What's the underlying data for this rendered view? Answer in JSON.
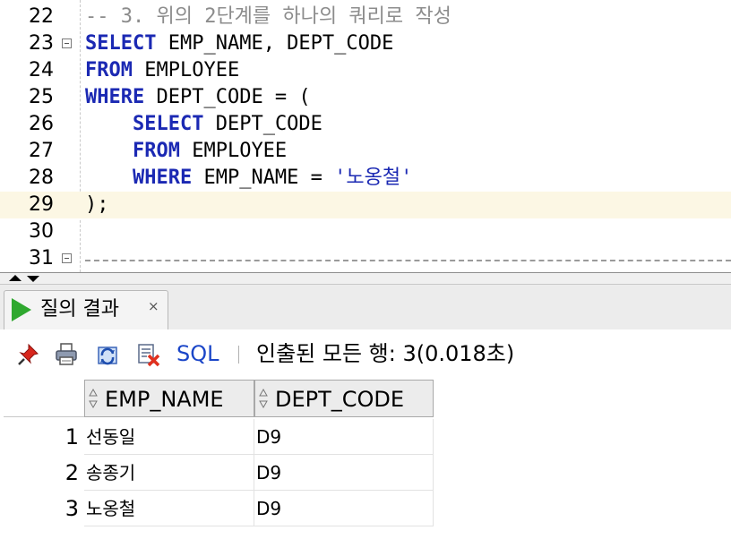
{
  "editor": {
    "lines": [
      {
        "num": "22",
        "tokens": [
          {
            "t": "-- 3. 위의 2단계를 하나의 쿼리로 작성",
            "c": "cmt"
          }
        ]
      },
      {
        "num": "23",
        "fold": true,
        "tokens": [
          {
            "t": "SELECT",
            "c": "kw"
          },
          {
            "t": " EMP_NAME, DEPT_CODE",
            "c": ""
          }
        ]
      },
      {
        "num": "24",
        "tokens": [
          {
            "t": "FROM",
            "c": "kw"
          },
          {
            "t": " EMPLOYEE",
            "c": ""
          }
        ]
      },
      {
        "num": "25",
        "tokens": [
          {
            "t": "WHERE",
            "c": "kw"
          },
          {
            "t": " DEPT_CODE = (",
            "c": ""
          }
        ]
      },
      {
        "num": "26",
        "tokens": [
          {
            "t": "    ",
            "c": ""
          },
          {
            "t": "SELECT",
            "c": "kw"
          },
          {
            "t": " DEPT_CODE",
            "c": ""
          }
        ]
      },
      {
        "num": "27",
        "tokens": [
          {
            "t": "    ",
            "c": ""
          },
          {
            "t": "FROM",
            "c": "kw"
          },
          {
            "t": " EMPLOYEE",
            "c": ""
          }
        ]
      },
      {
        "num": "28",
        "tokens": [
          {
            "t": "    ",
            "c": ""
          },
          {
            "t": "WHERE",
            "c": "kw"
          },
          {
            "t": " EMP_NAME = ",
            "c": ""
          },
          {
            "t": "'노옹철'",
            "c": "str"
          }
        ]
      },
      {
        "num": "29",
        "current": true,
        "tokens": [
          {
            "t": ");",
            "c": ""
          }
        ]
      },
      {
        "num": "30",
        "tokens": []
      },
      {
        "num": "31",
        "fold": true,
        "dashed": true,
        "tokens": []
      }
    ]
  },
  "results_tab": {
    "label": "질의 결과",
    "close_glyph": "×"
  },
  "toolbar": {
    "pin_icon": "pin-icon",
    "print_icon": "print-icon",
    "refresh_icon": "refresh-icon",
    "clear_icon": "clear-icon",
    "sql_label": "SQL",
    "status": "인출된 모든 행: 3(0.018초)"
  },
  "grid": {
    "columns": [
      "EMP_NAME",
      "DEPT_CODE"
    ],
    "rows": [
      {
        "num": "1",
        "cells": [
          "선동일",
          "D9"
        ]
      },
      {
        "num": "2",
        "cells": [
          "송종기",
          "D9"
        ]
      },
      {
        "num": "3",
        "cells": [
          "노옹철",
          "D9"
        ]
      }
    ]
  },
  "colors": {
    "keyword": "#1b29b3",
    "comment": "#8c8c8c",
    "current_line": "#fcf7e4",
    "run_icon": "#2fa82f",
    "sql_link": "#1b46c8"
  }
}
